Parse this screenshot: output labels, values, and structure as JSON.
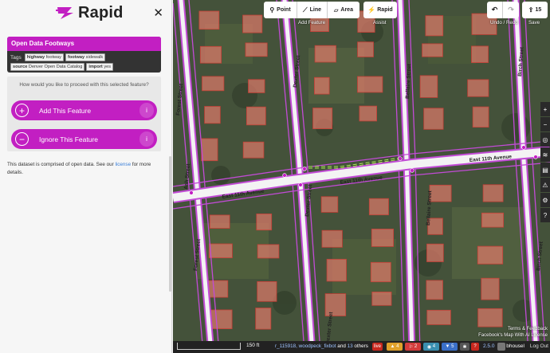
{
  "sidebar": {
    "brand": "Rapid",
    "close_icon": "close-icon",
    "feature_title": "Open Data Footways",
    "tags_label": "Tags",
    "tags": [
      {
        "key": "highway",
        "value": "footway"
      },
      {
        "key": "footway",
        "value": "sidewalk"
      },
      {
        "key": "source",
        "value": "Denver Open Data Catalog"
      },
      {
        "key": "import",
        "value": "yes"
      }
    ],
    "prompt": "How would you like to proceed with this selected feature?",
    "add_label": "Add This Feature",
    "ignore_label": "Ignore This Feature",
    "info_prefix": "This dataset is comprised of open data. See our ",
    "info_link": "license",
    "info_suffix": " for more details."
  },
  "toolbar": {
    "point": "Point",
    "line": "Line",
    "area": "Area",
    "add_feature_caption": "Add Feature",
    "assist_brand": "Rapid",
    "assist_caption": "Assist",
    "undo_redo_caption": "Undo / Redo",
    "save_count": "15",
    "save_caption": "Save"
  },
  "map": {
    "street_labels": [
      "East 11th Avenue",
      "East 11th Avenue",
      "East 11th Avenue",
      "Forest Street",
      "Forest Street",
      "Dexter Street",
      "Dexter Street",
      "Dexter Street",
      "Bellaire Street",
      "Bellaire Street",
      "Birch Street",
      "Birch Street",
      "Ash Street"
    ],
    "colors": {
      "road_outline": "#c24bd6",
      "road_fill": "#f3f3f3",
      "building": "#e07a6b",
      "footway": "#a8e65a",
      "accent": "#c21fc2"
    }
  },
  "status": {
    "scale_label": "150 ft",
    "commit_prefix": "r_115918, woodpeck_fixbot",
    "commit_and": " and ",
    "commit_count": "13",
    "commit_others": " others",
    "live": "live",
    "warnings": "4",
    "errors": "2",
    "issues_a": "4",
    "issues_b": "5",
    "version": "2.5.0",
    "username": "bhousel",
    "logout": "Log Out",
    "attribution_1": "Terms & Feedback",
    "attribution_2": "Facebook's Map With AI License"
  }
}
